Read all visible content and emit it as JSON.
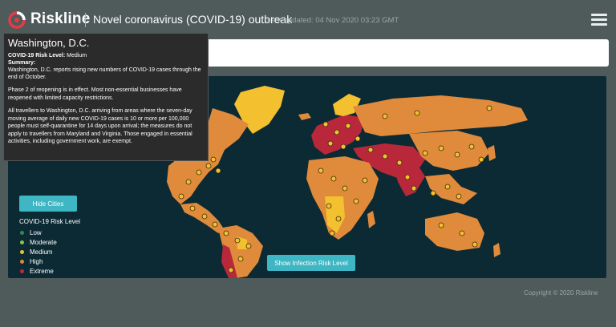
{
  "header": {
    "brand": "Riskline",
    "title": "Novel coronavirus (COVID-19) outbreak",
    "last_updated": "Last updated: 04 Nov 2020 03:23 GMT"
  },
  "search": {
    "value": "",
    "placeholder": ""
  },
  "tooltip": {
    "title": "Washington, D.C.",
    "risk_label": "COVID-19 Risk Level:",
    "risk_value": "Medium",
    "summary_label": "Summary:",
    "summary_text": "Washington, D.C. reports rising new numbers of COVID-19 cases through the end of October.",
    "para2": "Phase 2 of reopening is in effect. Most non-essential businesses have reopened with limited capacity restrictions.",
    "para3": "All travellers to Washington, D.C. arriving from areas where the seven-day moving average of daily new COVID-19 cases is 10 or more per 100,000 people must self-quarantine for 14 days upon arrival; the measures do not apply to travellers from Maryland and Virginia. Those engaged in essential activities, including government work, are exempt."
  },
  "buttons": {
    "hide_cities": "Hide Cities",
    "show_infection": "Show Infection Risk Level"
  },
  "legend": {
    "title": "COVID-19 Risk Level",
    "items": [
      {
        "label": "Low",
        "color": "#2e8b57"
      },
      {
        "label": "Moderate",
        "color": "#8bc34a"
      },
      {
        "label": "Medium",
        "color": "#f3c02f"
      },
      {
        "label": "High",
        "color": "#e7863b"
      },
      {
        "label": "Extreme",
        "color": "#c4273a"
      }
    ]
  },
  "colors": {
    "ocean": "#0b2a33",
    "high": "#e08a3c",
    "medium": "#f3c02f",
    "extreme": "#b8283a",
    "accent": "#3fb6c4"
  },
  "footer": {
    "copyright": "Copyright © 2020 Riskline"
  }
}
